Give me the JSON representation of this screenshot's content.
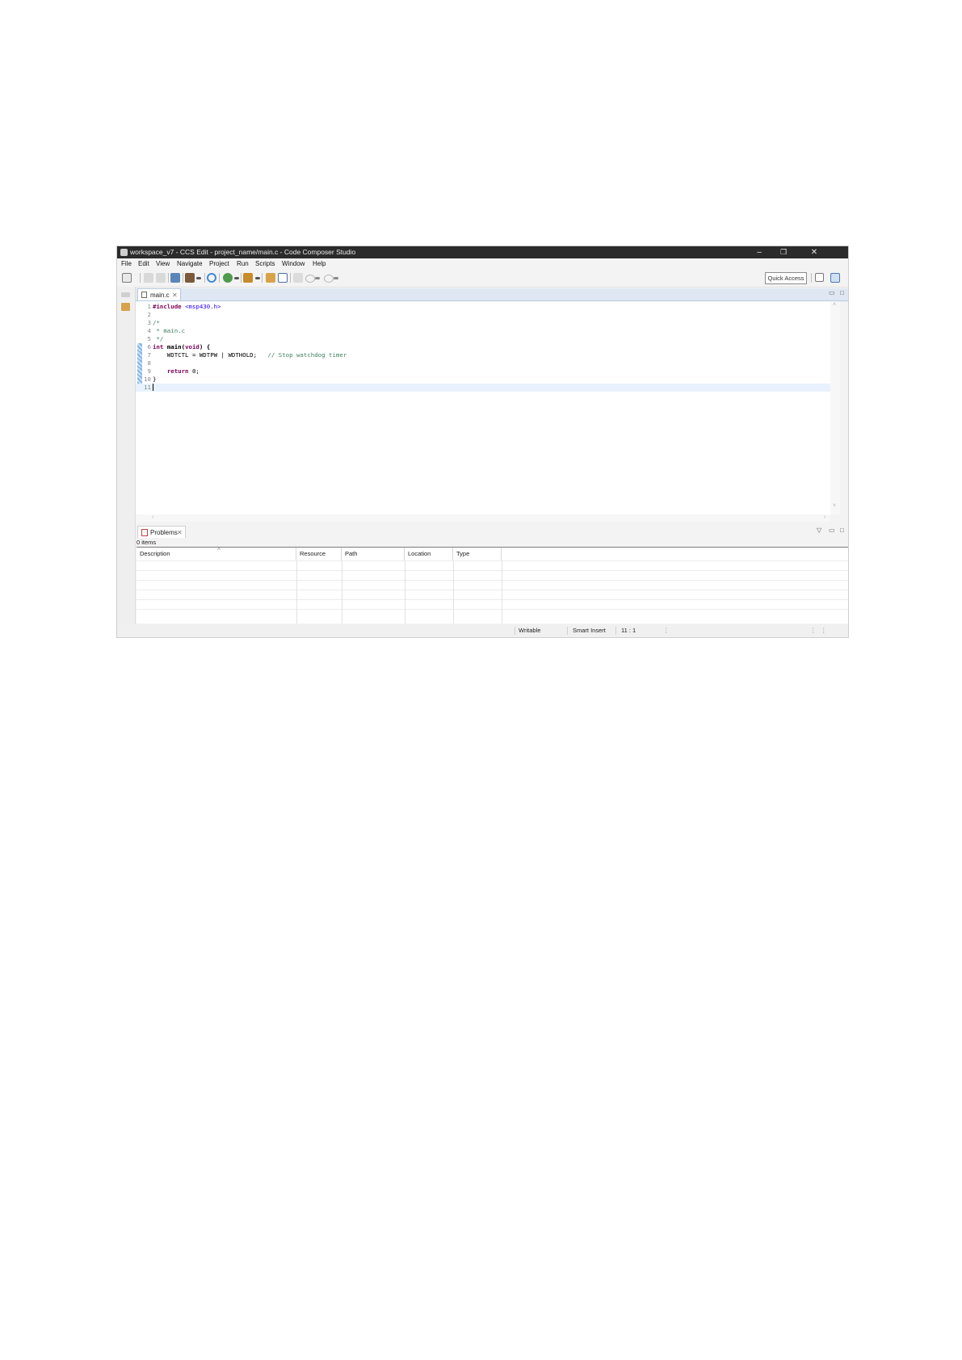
{
  "window": {
    "title": "workspace_v7 - CCS Edit - project_name/main.c - Code Composer Studio",
    "controls": {
      "minimize": "–",
      "restore": "❐",
      "close": "✕"
    }
  },
  "menubar": [
    "File",
    "Edit",
    "View",
    "Navigate",
    "Project",
    "Run",
    "Scripts",
    "Window",
    "Help"
  ],
  "toolbar": {
    "quick_access": "Quick Access"
  },
  "editor": {
    "tab_label": "main.c",
    "lines": [
      {
        "n": "1",
        "parts": [
          {
            "t": "#include",
            "c": "kw"
          },
          {
            "t": " "
          },
          {
            "t": "<msp430.h>",
            "c": "str"
          }
        ]
      },
      {
        "n": "2",
        "parts": []
      },
      {
        "n": "3",
        "parts": [
          {
            "t": "/*",
            "c": "cm"
          }
        ]
      },
      {
        "n": "4",
        "parts": [
          {
            "t": " * main.c",
            "c": "cm"
          }
        ]
      },
      {
        "n": "5",
        "parts": [
          {
            "t": " */",
            "c": "cm"
          }
        ]
      },
      {
        "n": "6",
        "parts": [
          {
            "t": "int",
            "c": "kw"
          },
          {
            "t": " "
          },
          {
            "t": "main",
            "c": "fn"
          },
          {
            "t": "(",
            "c": "fn"
          },
          {
            "t": "void",
            "c": "kw"
          },
          {
            "t": ") {",
            "c": "fn"
          }
        ],
        "marker": true
      },
      {
        "n": "7",
        "parts": [
          {
            "t": "    WDTCTL = WDTPW | WDTHOLD;   "
          },
          {
            "t": "// Stop watchdog timer",
            "c": "cm"
          }
        ],
        "marker": true
      },
      {
        "n": "8",
        "parts": [],
        "marker": true
      },
      {
        "n": "9",
        "parts": [
          {
            "t": "    "
          },
          {
            "t": "return",
            "c": "kw"
          },
          {
            "t": " 0;"
          }
        ],
        "marker": true
      },
      {
        "n": "10",
        "parts": [
          {
            "t": "}"
          }
        ],
        "marker": true
      },
      {
        "n": "11",
        "parts": [],
        "current": true
      }
    ]
  },
  "problems": {
    "tab_label": "Problems",
    "count": "0 items",
    "columns": [
      "Description",
      "Resource",
      "Path",
      "Location",
      "Type"
    ]
  },
  "statusbar": {
    "writable": "Writable",
    "insert_mode": "Smart Insert",
    "position": "11 : 1"
  },
  "colors": {
    "titlebar": "#2b2b2b",
    "keyword": "#7f0055",
    "string": "#2a00ff",
    "comment": "#3f7f5f",
    "current_line": "#e8f2fe"
  }
}
